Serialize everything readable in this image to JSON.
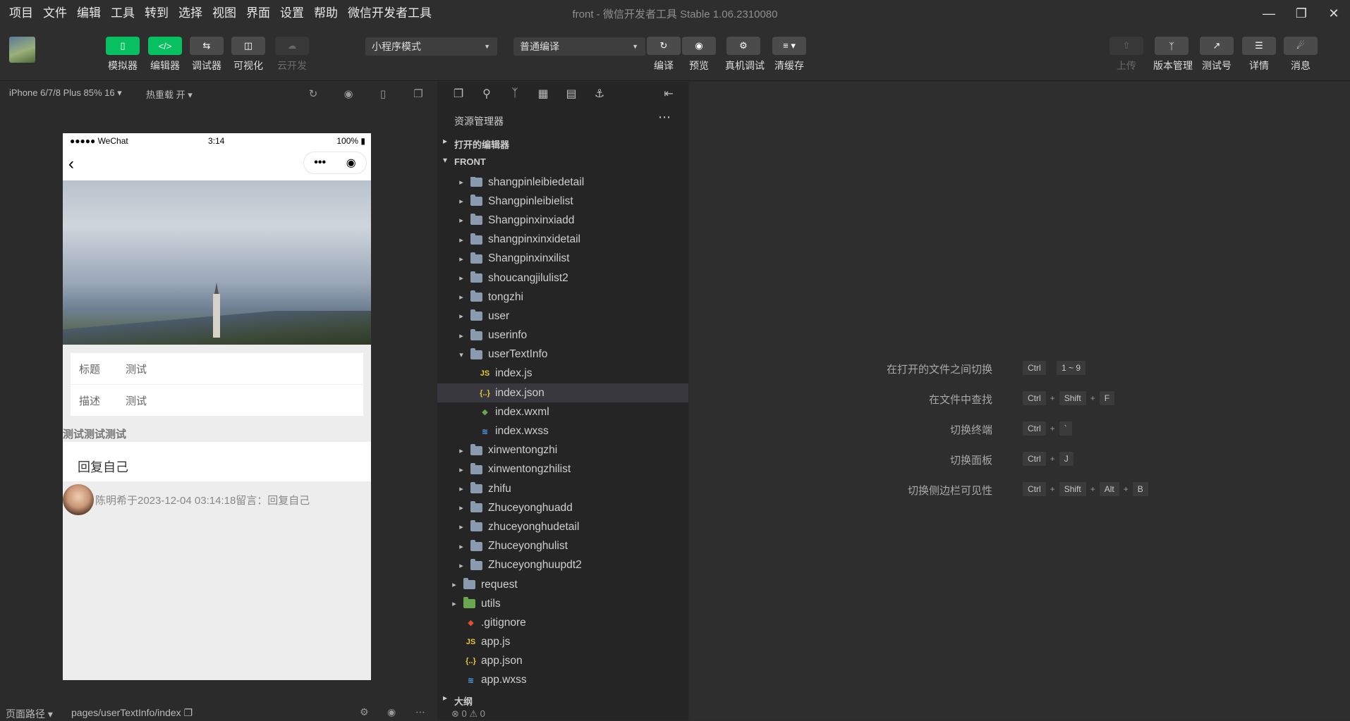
{
  "menu": [
    "项目",
    "文件",
    "编辑",
    "工具",
    "转到",
    "选择",
    "视图",
    "界面",
    "设置",
    "帮助",
    "微信开发者工具"
  ],
  "window_title": "front - 微信开发者工具 Stable 1.06.2310080",
  "toolbar": {
    "left_buttons": [
      {
        "label": "模拟器",
        "icon": "phone-icon"
      },
      {
        "label": "编辑器",
        "icon": "code-icon"
      },
      {
        "label": "调试器",
        "icon": "debug-icon"
      },
      {
        "label": "可视化",
        "icon": "layout-icon"
      },
      {
        "label": "云开发",
        "icon": "cloud-icon"
      }
    ],
    "mode_select": "小程序模式",
    "compile_select": "普通编译",
    "mid_buttons": [
      {
        "label": "编译",
        "icon": "refresh-icon"
      },
      {
        "label": "预览",
        "icon": "eye-icon"
      },
      {
        "label": "真机调试",
        "icon": "bug-icon"
      },
      {
        "label": "清缓存",
        "icon": "layers-icon"
      }
    ],
    "right_buttons": [
      {
        "label": "上传",
        "icon": "upload-icon"
      },
      {
        "label": "版本管理",
        "icon": "branch-icon"
      },
      {
        "label": "测试号",
        "icon": "external-icon"
      },
      {
        "label": "详情",
        "icon": "menu-icon"
      },
      {
        "label": "消息",
        "icon": "bell-icon"
      }
    ]
  },
  "simulator": {
    "device": "iPhone 6/7/8 Plus 85% 16",
    "hot_reload": "热重载 开",
    "status": {
      "carrier": "●●●●● WeChat",
      "time": "3:14",
      "battery": "100%"
    },
    "form": [
      {
        "key": "标题",
        "value": "测试"
      },
      {
        "key": "描述",
        "value": "测试"
      }
    ],
    "detail_text": "测试测试测试",
    "reply_text": "回复自己",
    "comment_text": "陈明希于2023-12-04 03:14:18留言：回复自己"
  },
  "explorer": {
    "title": "资源管理器",
    "open_editors": "打开的编辑器",
    "project": "FRONT",
    "outline": "大纲",
    "errors": "0",
    "warnings": "0",
    "tree": [
      {
        "name": "shangpinleibiedetail",
        "type": "folder",
        "depth": 2
      },
      {
        "name": "Shangpinleibielist",
        "type": "folder",
        "depth": 2
      },
      {
        "name": "Shangpinxinxiadd",
        "type": "folder",
        "depth": 2
      },
      {
        "name": "shangpinxinxidetail",
        "type": "folder",
        "depth": 2
      },
      {
        "name": "Shangpinxinxilist",
        "type": "folder",
        "depth": 2
      },
      {
        "name": "shoucangjilulist2",
        "type": "folder",
        "depth": 2
      },
      {
        "name": "tongzhi",
        "type": "folder",
        "depth": 2
      },
      {
        "name": "user",
        "type": "folder",
        "depth": 2
      },
      {
        "name": "userinfo",
        "type": "folder",
        "depth": 2
      },
      {
        "name": "userTextInfo",
        "type": "folder-open",
        "depth": 2
      },
      {
        "name": "index.js",
        "type": "js",
        "depth": 3
      },
      {
        "name": "index.json",
        "type": "json",
        "depth": 3,
        "selected": true
      },
      {
        "name": "index.wxml",
        "type": "wxml",
        "depth": 3
      },
      {
        "name": "index.wxss",
        "type": "wxss",
        "depth": 3
      },
      {
        "name": "xinwentongzhi",
        "type": "folder",
        "depth": 2
      },
      {
        "name": "xinwentongzhilist",
        "type": "folder",
        "depth": 2
      },
      {
        "name": "zhifu",
        "type": "folder",
        "depth": 2
      },
      {
        "name": "Zhuceyonghuadd",
        "type": "folder",
        "depth": 2
      },
      {
        "name": "zhuceyonghudetail",
        "type": "folder",
        "depth": 2
      },
      {
        "name": "Zhuceyonghulist",
        "type": "folder",
        "depth": 2
      },
      {
        "name": "Zhuceyonghuupdt2",
        "type": "folder",
        "depth": 2
      },
      {
        "name": "request",
        "type": "folder",
        "depth": 1
      },
      {
        "name": "utils",
        "type": "folder-green",
        "depth": 1
      },
      {
        "name": ".gitignore",
        "type": "git",
        "depth": 1
      },
      {
        "name": "app.js",
        "type": "js",
        "depth": 1
      },
      {
        "name": "app.json",
        "type": "json",
        "depth": 1
      },
      {
        "name": "app.wxss",
        "type": "wxss",
        "depth": 1
      }
    ]
  },
  "shortcuts": [
    {
      "label": "在打开的文件之间切换",
      "keys": [
        "Ctrl",
        "1 ~ 9"
      ]
    },
    {
      "label": "在文件中查找",
      "keys": [
        "Ctrl",
        "Shift",
        "F"
      ]
    },
    {
      "label": "切换终端",
      "keys": [
        "Ctrl",
        "`"
      ]
    },
    {
      "label": "切换面板",
      "keys": [
        "Ctrl",
        "J"
      ]
    },
    {
      "label": "切换侧边栏可见性",
      "keys": [
        "Ctrl",
        "Shift",
        "Alt",
        "B"
      ]
    }
  ],
  "bottombar": {
    "page_path_label": "页面路径",
    "page_path": "pages/userTextInfo/index"
  }
}
